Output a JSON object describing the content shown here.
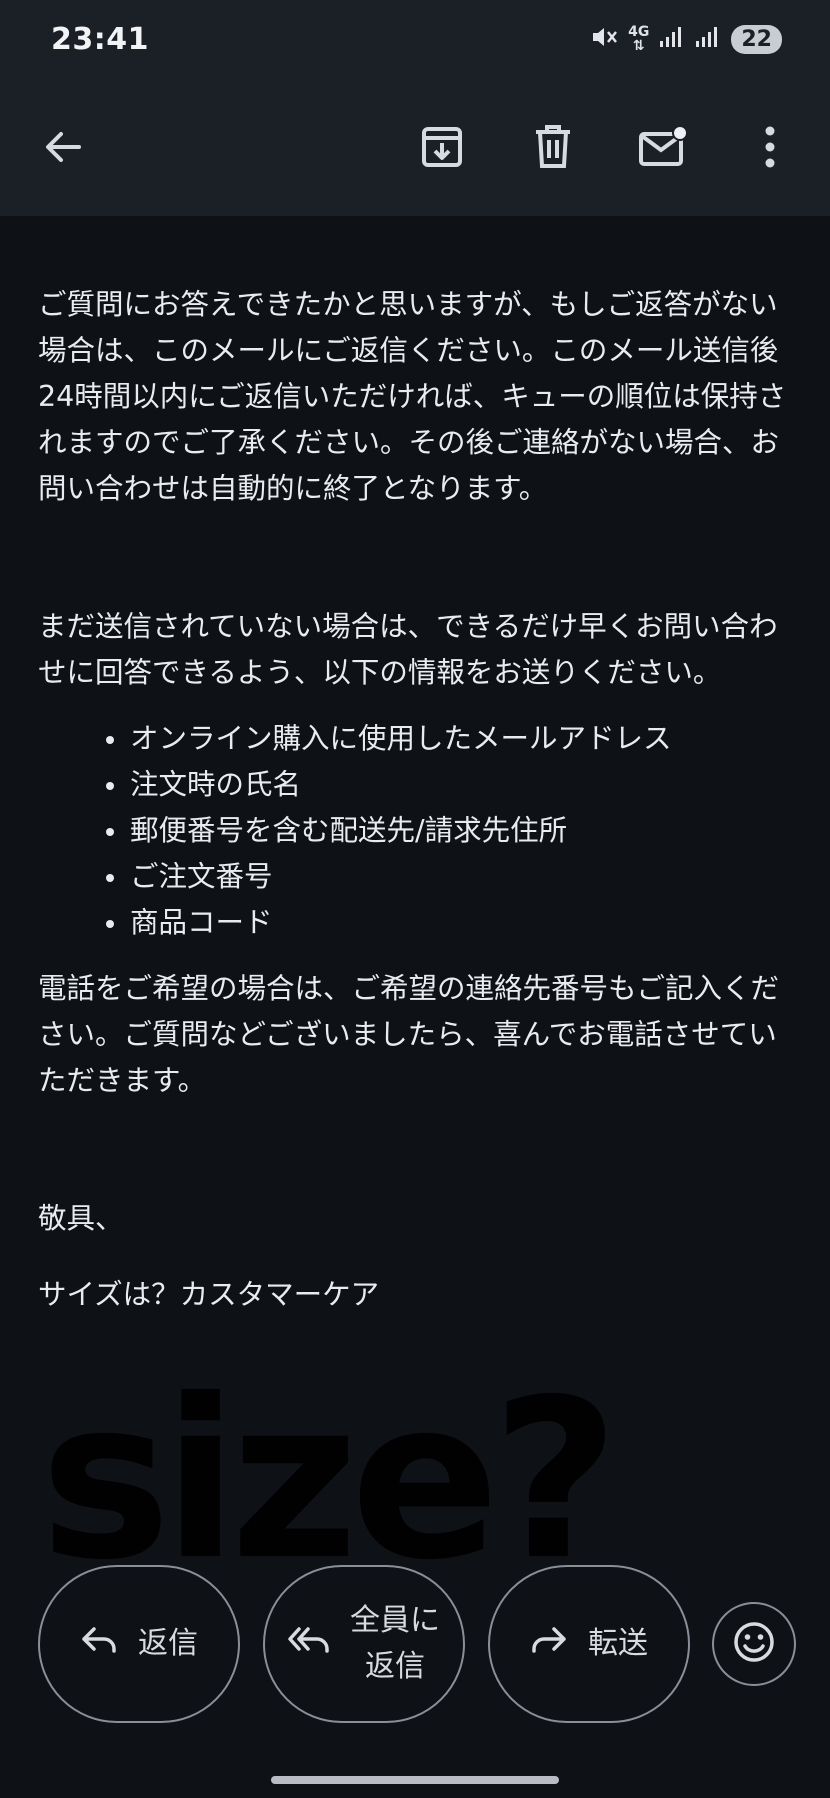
{
  "status_bar": {
    "time": "23:41",
    "network": "4G",
    "battery": "22"
  },
  "toolbar": {
    "back_icon": "arrow-back-icon",
    "archive_icon": "archive-icon",
    "delete_icon": "trash-icon",
    "mark_unread_icon": "mail-unread-icon",
    "more_icon": "more-vert-icon"
  },
  "body": {
    "p1": "ご質問にお答えできたかと思いますが、もしご返答がない場合は、このメールにご返信ください。このメール送信後24時間以内にご返信いただければ、キューの順位は保持されますのでご了承ください。その後ご連絡がない場合、お問い合わせは自動的に終了となります。",
    "p2": "まだ送信されていない場合は、できるだけ早くお問い合わせに回答できるよう、以下の情報をお送りください。",
    "items": [
      "オンライン購入に使用したメールアドレス",
      "注文時の氏名",
      "郵便番号を含む配送先/請求先住所",
      "ご注文番号",
      "商品コード"
    ],
    "p3": "電話をご希望の場合は、ご希望の連絡先番号もご記入ください。ご質問などございましたら、喜んでお電話させていただきます。",
    "closing": "敬具、",
    "signature": "サイズは？カスタマーケア",
    "logo_text": "size?"
  },
  "actions": {
    "reply": "返信",
    "reply_all_line1": "全員に",
    "reply_all_line2": "返信",
    "forward": "転送",
    "emoji_icon": "emoji-icon"
  },
  "colors": {
    "background": "#0e1116",
    "bar": "#1b1f26",
    "text": "#e9ebef",
    "outline": "#8a8e96"
  }
}
